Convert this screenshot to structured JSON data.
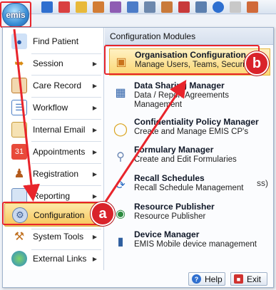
{
  "emis_logo": "emis",
  "toolbar": {
    "icons": [
      "back-icon",
      "home-icon",
      "pen-icon",
      "patient-icon",
      "notes-icon",
      "card-icon",
      "users-icon",
      "calendar-icon",
      "list-icon",
      "info-icon",
      "scissors-icon",
      "tools-icon"
    ]
  },
  "left_menu": [
    {
      "label": "Find Patient",
      "icon": "find-patient-icon",
      "has_submenu": false
    },
    {
      "label": "Session",
      "icon": "session-icon",
      "has_submenu": true
    },
    {
      "label": "Care Record",
      "icon": "care-record-icon",
      "has_submenu": true
    },
    {
      "label": "Workflow",
      "icon": "workflow-icon",
      "has_submenu": true
    },
    {
      "label": "Internal Email",
      "icon": "email-icon",
      "has_submenu": true
    },
    {
      "label": "Appointments",
      "icon": "appointments-icon",
      "has_submenu": true
    },
    {
      "label": "Registration",
      "icon": "registration-icon",
      "has_submenu": true
    },
    {
      "label": "Reporting",
      "icon": "reporting-icon",
      "has_submenu": true
    },
    {
      "label": "Configuration",
      "icon": "configuration-icon",
      "has_submenu": true,
      "active": true
    },
    {
      "label": "System Tools",
      "icon": "system-tools-icon",
      "has_submenu": true
    },
    {
      "label": "External Links",
      "icon": "external-links-icon",
      "has_submenu": true
    }
  ],
  "submenu": {
    "header": "Configuration Modules",
    "items": [
      {
        "title": "Organisation Configuration",
        "desc": [
          "Manage Users, Teams, Security"
        ],
        "icon": "org-chart-icon",
        "highlighted": true
      },
      {
        "title": "Data Sharing Manager",
        "desc": [
          "Data / Report Agreements",
          "Management"
        ],
        "icon": "data-sharing-icon"
      },
      {
        "title": "Confidentiality Policy Manager",
        "desc": [
          "Create and Manage EMIS CP's"
        ],
        "icon": "lock-icon"
      },
      {
        "title": "Formulary Manager",
        "desc": [
          "Create and Edit Formularies"
        ],
        "icon": "formulary-icon"
      },
      {
        "title": "Recall Schedules",
        "desc": [
          "Recall Schedule Management"
        ],
        "icon": "recall-icon"
      },
      {
        "title": "Resource Publisher",
        "desc": [
          "Resource Publisher"
        ],
        "icon": "globe-icon"
      },
      {
        "title": "Device Manager",
        "desc": [
          "EMIS Mobile device management"
        ],
        "icon": "device-icon"
      }
    ]
  },
  "background_text": "ss)",
  "buttons": {
    "help": "Help",
    "exit": "Exit"
  },
  "annotations": {
    "a": "a",
    "b": "b"
  },
  "colors": {
    "annotation_red": "#e8242b",
    "highlight_gold": "#f6c55a"
  }
}
